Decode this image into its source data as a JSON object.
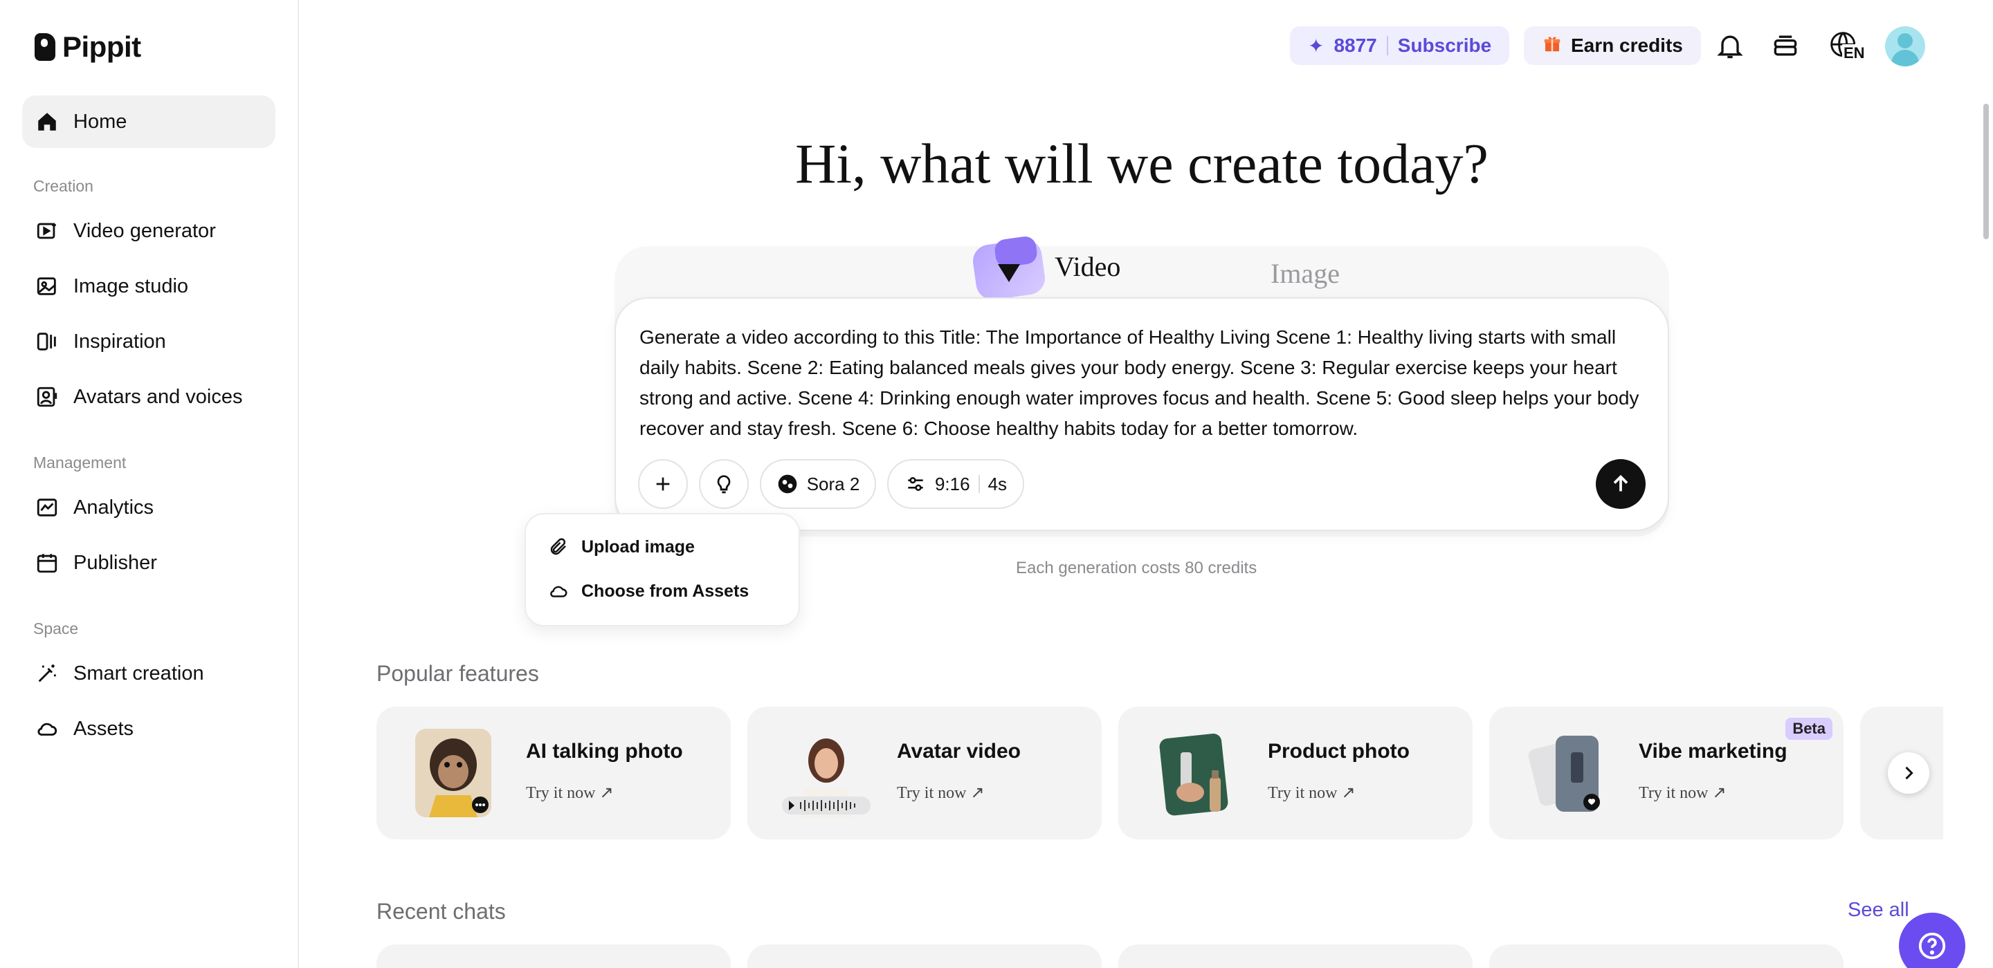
{
  "app": {
    "name": "Pippit"
  },
  "sidebar": {
    "home": "Home",
    "sections": [
      {
        "label": "Creation",
        "items": [
          "Video generator",
          "Image studio",
          "Inspiration",
          "Avatars and voices"
        ]
      },
      {
        "label": "Management",
        "items": [
          "Analytics",
          "Publisher"
        ]
      },
      {
        "label": "Space",
        "items": [
          "Smart creation",
          "Assets"
        ]
      }
    ]
  },
  "topbar": {
    "credits": "8877",
    "subscribe": "Subscribe",
    "earn_credits": "Earn credits",
    "language": "EN"
  },
  "hero": {
    "title": "Hi, what will we create today?"
  },
  "composer": {
    "tabs": {
      "video": "Video",
      "image": "Image"
    },
    "prompt": "Generate a video according to this Title: The Importance of Healthy Living Scene 1: Healthy living starts with small daily habits. Scene 2: Eating balanced meals gives your body energy. Scene 3: Regular exercise keeps your heart strong and active. Scene 4: Drinking enough water improves focus and health. Scene 5: Good sleep helps your body recover and stay fresh. Scene 6: Choose healthy habits today for a better tomorrow.",
    "model": "Sora 2",
    "ratio": "9:16",
    "duration": "4s",
    "cost_note": "Each generation costs 80 credits"
  },
  "attach_menu": {
    "upload_image": "Upload image",
    "choose_assets": "Choose from Assets"
  },
  "popular": {
    "title": "Popular features",
    "try_label": "Try it now ↗",
    "features": [
      {
        "name": "AI talking photo"
      },
      {
        "name": "Avatar video"
      },
      {
        "name": "Product photo"
      },
      {
        "name": "Vibe marketing",
        "badge": "Beta"
      }
    ]
  },
  "recent": {
    "title": "Recent chats",
    "see_all": "See all"
  },
  "colors": {
    "accent": "#5b4ad8",
    "help": "#6a4cf0"
  }
}
